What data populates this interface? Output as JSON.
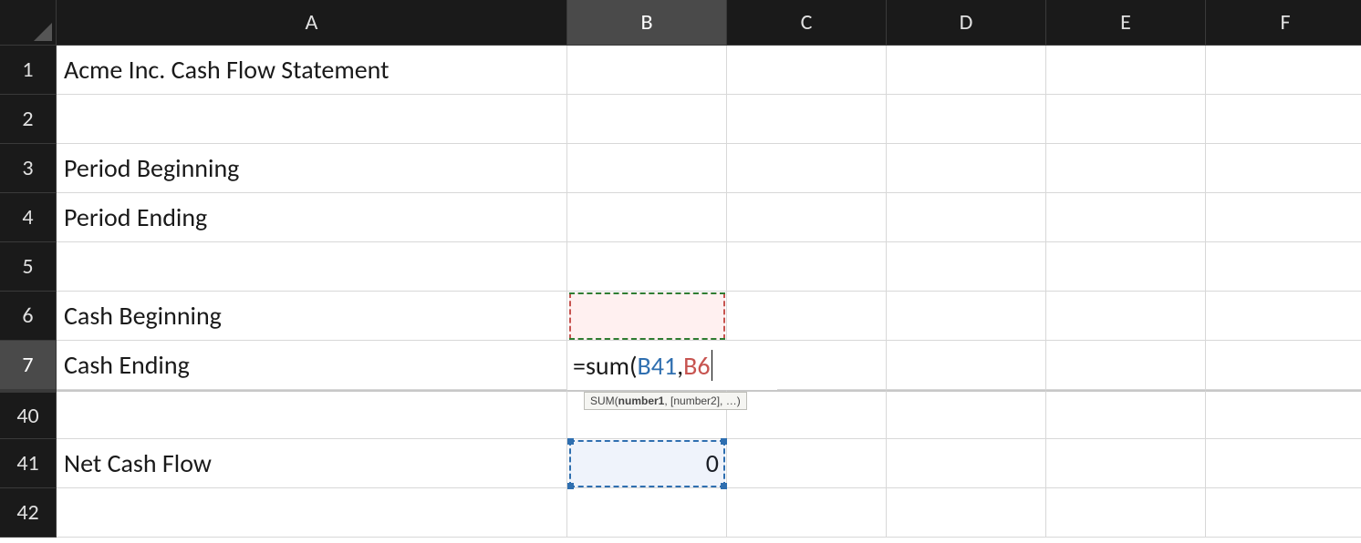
{
  "columns": [
    {
      "id": "A",
      "label": "A",
      "width": "cA",
      "selected": false
    },
    {
      "id": "B",
      "label": "B",
      "width": "cB",
      "selected": true
    },
    {
      "id": "C",
      "label": "C",
      "width": "cC",
      "selected": false
    },
    {
      "id": "D",
      "label": "D",
      "width": "cD",
      "selected": false
    },
    {
      "id": "E",
      "label": "E",
      "width": "cE",
      "selected": false
    },
    {
      "id": "F",
      "label": "F",
      "width": "cF",
      "selected": false
    }
  ],
  "rows": [
    {
      "n": "1",
      "selected": false
    },
    {
      "n": "2",
      "selected": false
    },
    {
      "n": "3",
      "selected": false
    },
    {
      "n": "4",
      "selected": false
    },
    {
      "n": "5",
      "selected": false
    },
    {
      "n": "6",
      "selected": false
    },
    {
      "n": "7",
      "selected": true
    },
    {
      "n": "40",
      "selected": false,
      "break": true
    },
    {
      "n": "41",
      "selected": false
    },
    {
      "n": "42",
      "selected": false
    }
  ],
  "cells": {
    "A1": "Acme Inc. Cash Flow Statement",
    "A3": "Period Beginning",
    "A4": "Period Ending",
    "A6": "Cash Beginning",
    "A7": "Cash Ending",
    "A41": "Net Cash Flow",
    "B41": "0"
  },
  "formula": {
    "cell": "B7",
    "prefix": "=sum(",
    "ref1": "B41",
    "sep": ",",
    "ref2": "B6"
  },
  "tooltip": {
    "fn": "SUM",
    "arg_bold": "number1",
    "rest": ", [number2], …)"
  }
}
